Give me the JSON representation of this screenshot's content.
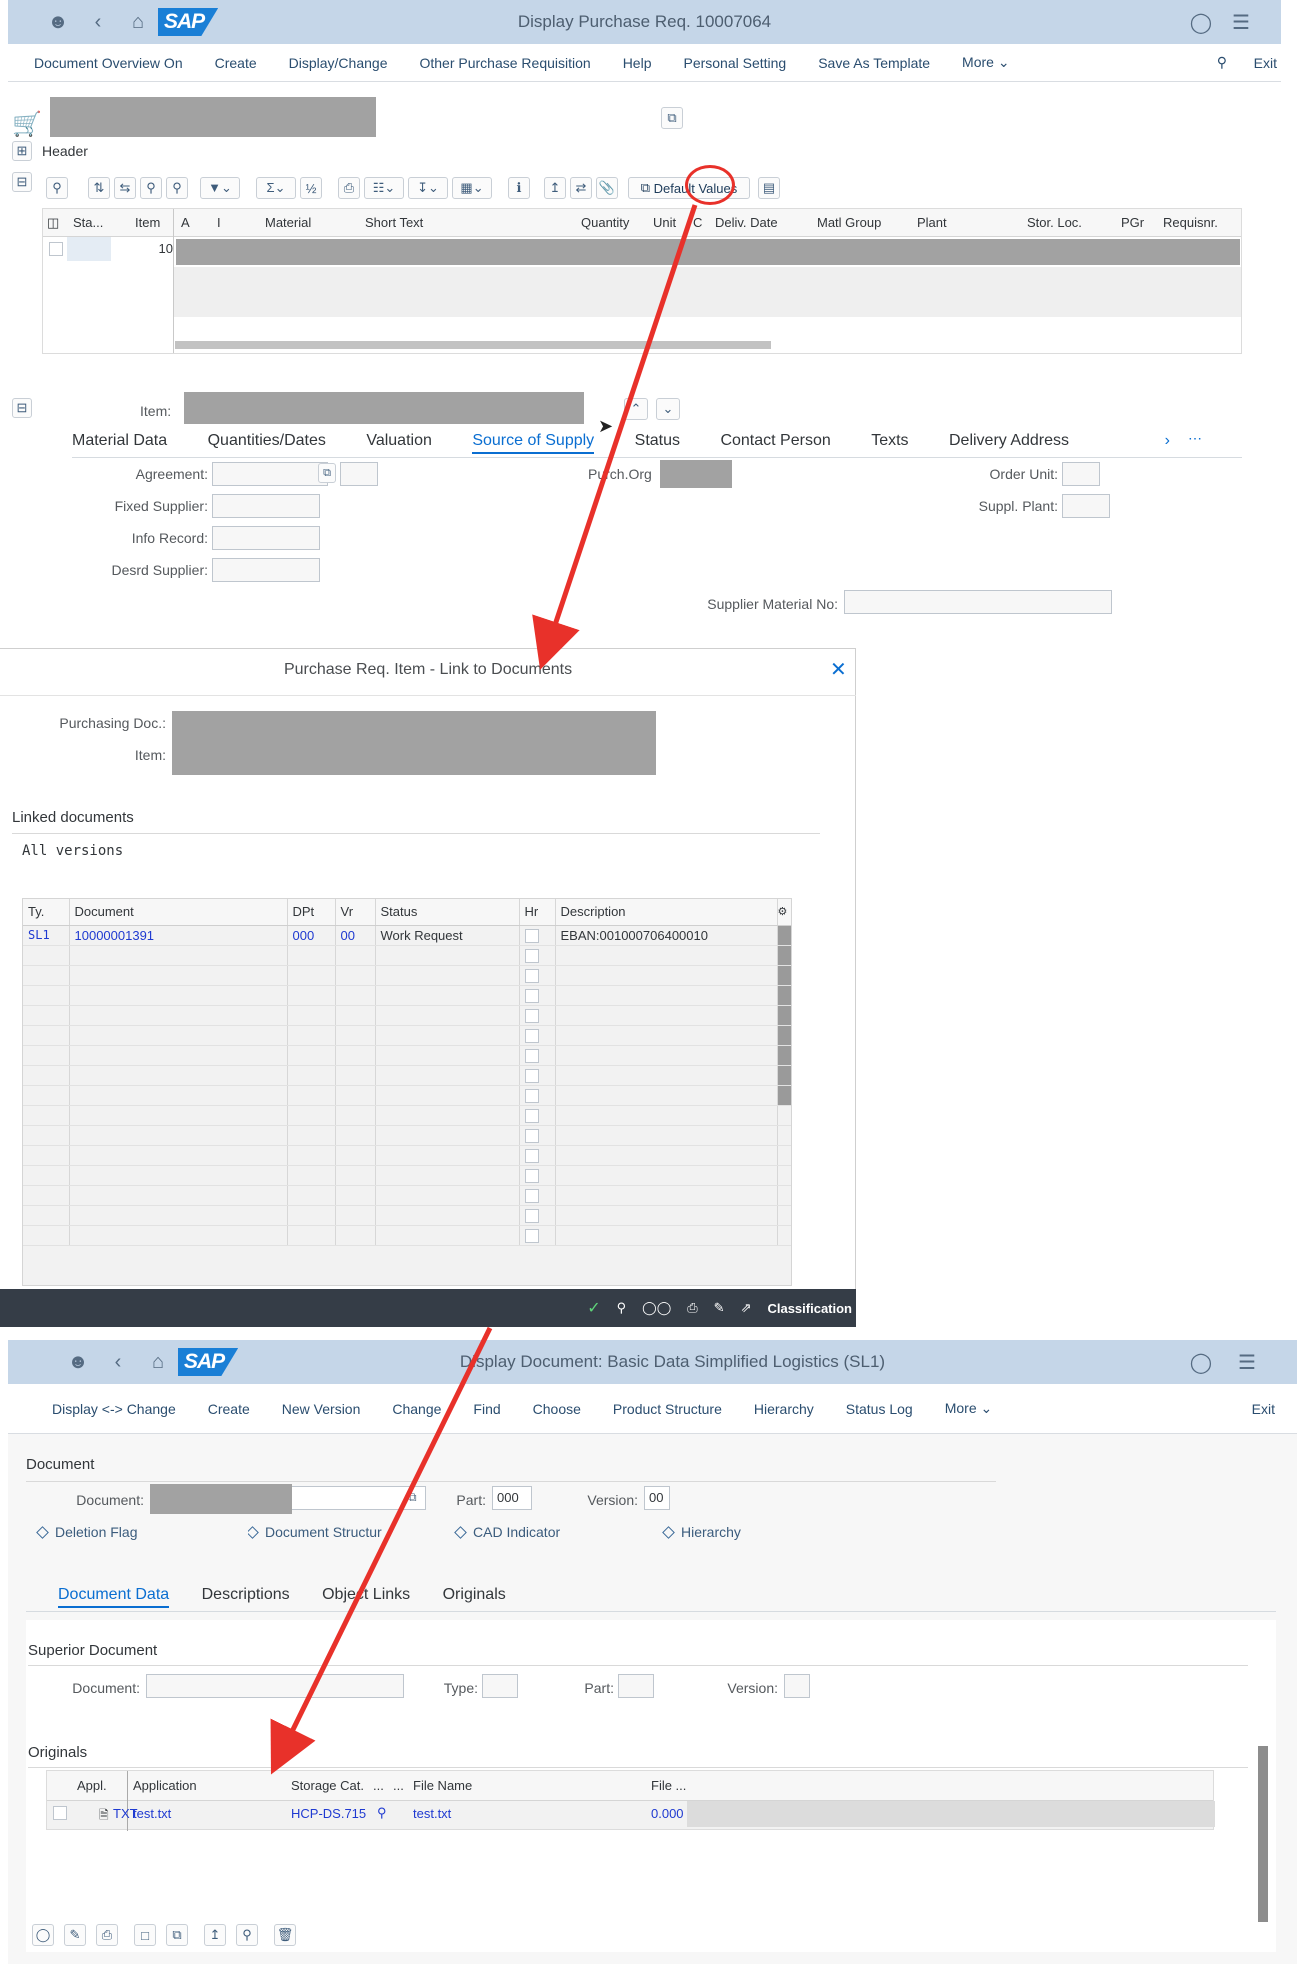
{
  "top": {
    "title": "Display Purchase Req. 10007064",
    "menu": [
      "Document Overview On",
      "Create",
      "Display/Change",
      "Other Purchase Requisition",
      "Help",
      "Personal Setting",
      "Save As Template",
      "More"
    ],
    "exit": "Exit",
    "header_label": "Header",
    "default_values": "Default Values",
    "columns": [
      "Sta...",
      "Item",
      "A",
      "I",
      "Material",
      "Short Text",
      "Quantity",
      "Unit",
      "C",
      "Deliv. Date",
      "Matl Group",
      "Plant",
      "Stor. Loc.",
      "PGr",
      "Requisnr."
    ],
    "row_item": "10",
    "item_label": "Item:",
    "tabs": [
      "Material Data",
      "Quantities/Dates",
      "Valuation",
      "Source of Supply",
      "Status",
      "Contact Person",
      "Texts",
      "Delivery Address"
    ],
    "fields": {
      "agreement": "Agreement:",
      "fixed_supplier": "Fixed Supplier:",
      "info_record": "Info Record:",
      "desrd_supplier": "Desrd Supplier:",
      "purch_org": "Purch.Org",
      "order_unit": "Order Unit:",
      "suppl_plant": "Suppl. Plant:",
      "supplier_material": "Supplier Material No:"
    }
  },
  "dialog": {
    "title": "Purchase Req. Item - Link to Documents",
    "purchasing_doc": "Purchasing Doc.:",
    "item": "Item:",
    "linked_documents": "Linked documents",
    "all_versions": "All versions",
    "columns": [
      "Ty.",
      "Document",
      "DPt",
      "Vr",
      "Status",
      "Hr",
      "Description"
    ],
    "row": {
      "ty": "SL1",
      "document": "10000001391",
      "dpt": "000",
      "vr": "00",
      "status": "Work Request",
      "description": "EBAN:001000706400010"
    },
    "footer_classification": "Classification"
  },
  "bottom": {
    "title": "Display Document: Basic Data Simplified Logistics (SL1)",
    "menu": [
      "Display <-> Change",
      "Create",
      "New Version",
      "Change",
      "Find",
      "Choose",
      "Product Structure",
      "Hierarchy",
      "Status Log",
      "More"
    ],
    "exit": "Exit",
    "document_section": "Document",
    "document_label": "Document:",
    "part_label": "Part:",
    "part_value": "000",
    "version_label": "Version:",
    "version_value": "00",
    "flags": [
      "Deletion Flag",
      "Document Structur",
      "CAD Indicator",
      "Hierarchy"
    ],
    "tabs": [
      "Document Data",
      "Descriptions",
      "Object Links",
      "Originals"
    ],
    "superior_document": "Superior Document",
    "sup_document": "Document:",
    "sup_type": "Type:",
    "sup_part": "Part:",
    "sup_version": "Version:",
    "originals": "Originals",
    "orig_columns": [
      "Appl.",
      "Application",
      "Storage Cat.",
      "...",
      "...",
      "File Name",
      "File ..."
    ],
    "orig_row": {
      "appl": "TXT",
      "application": "test.txt",
      "storage": "HCP-DS.715",
      "file_name": "test.txt",
      "file_size": "0.000"
    }
  },
  "colors": {
    "accent": "#0a6ed1",
    "annotation": "#e8312a",
    "shell": "#c5d6e8"
  }
}
